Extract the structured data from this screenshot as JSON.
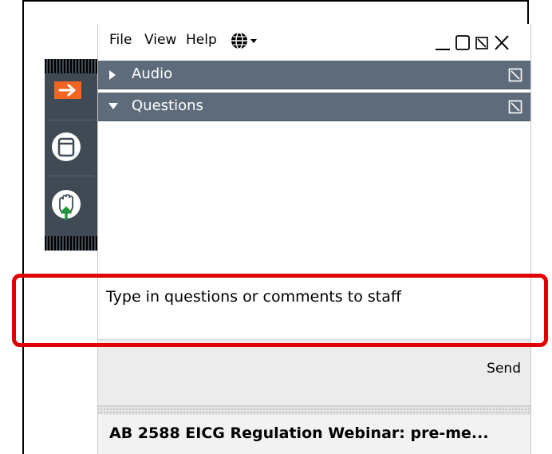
{
  "menubar": {
    "file": "File",
    "view": "View",
    "help": "Help",
    "globe_icon": "globe-icon"
  },
  "window_controls": {
    "minimize_icon": "minimize-icon",
    "restore_icon": "restore-icon",
    "popout_icon": "popout-icon",
    "close_icon": "close-icon"
  },
  "sections": [
    {
      "label": "Audio",
      "expanded": false
    },
    {
      "label": "Questions",
      "expanded": true
    }
  ],
  "questions": {
    "placeholder": "Type in questions or comments to staff",
    "send_label": "Send"
  },
  "webinar": {
    "title": "AB 2588 EICG Regulation Webinar: pre-me..."
  },
  "toolbar": {
    "items": [
      {
        "icon": "arrow-right-icon",
        "color": "#f26522"
      },
      {
        "icon": "window-icon"
      },
      {
        "icon": "raise-hand-icon",
        "color": "#1a9a3a"
      }
    ]
  },
  "colors": {
    "section_bar": "#5d6b7b",
    "toolbar_bg": "#3f4a55",
    "highlight": "#e00000"
  }
}
